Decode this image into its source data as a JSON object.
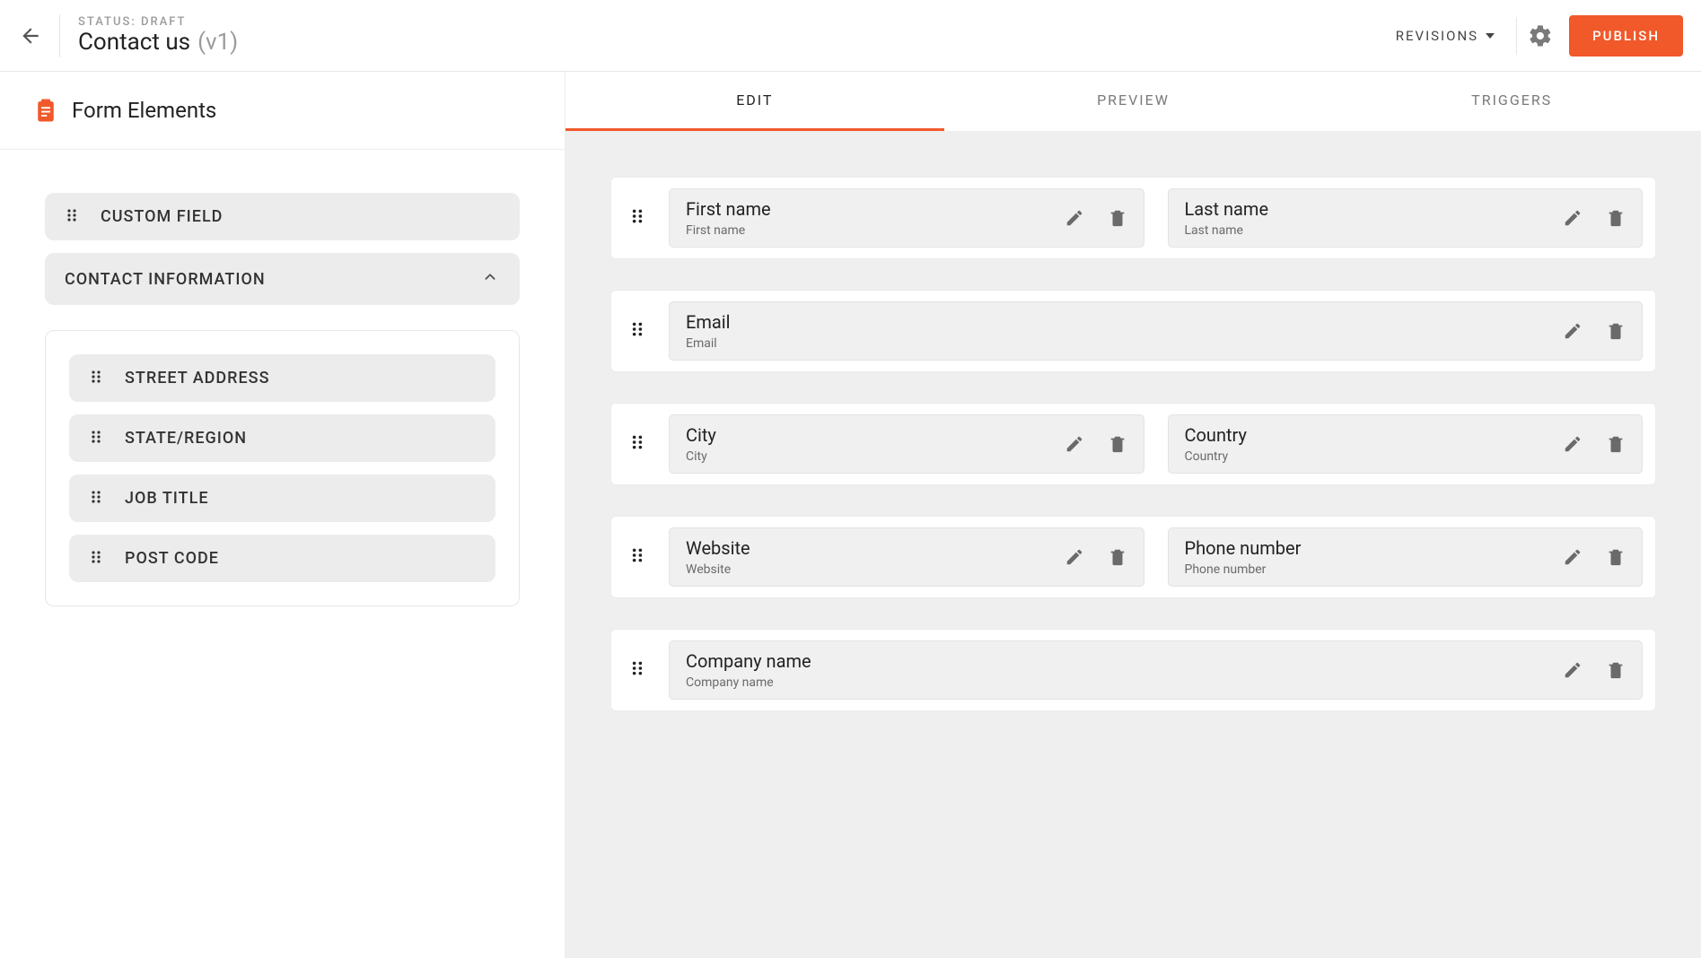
{
  "header": {
    "status_label": "STATUS: DRAFT",
    "title": "Contact us",
    "version": "(v1)",
    "revisions_label": "REVISIONS",
    "publish_label": "PUBLISH"
  },
  "sidebar": {
    "title": "Form Elements",
    "custom_field_label": "CUSTOM FIELD",
    "section_label": "CONTACT INFORMATION",
    "items": [
      {
        "label": "STREET ADDRESS"
      },
      {
        "label": "STATE/REGION"
      },
      {
        "label": "JOB TITLE"
      },
      {
        "label": "POST CODE"
      }
    ]
  },
  "tabs": {
    "edit": "EDIT",
    "preview": "PREVIEW",
    "triggers": "TRIGGERS",
    "active": "edit"
  },
  "rows": [
    {
      "fields": [
        {
          "title": "First name",
          "sub": "First name"
        },
        {
          "title": "Last name",
          "sub": "Last name"
        }
      ]
    },
    {
      "fields": [
        {
          "title": "Email",
          "sub": "Email"
        }
      ]
    },
    {
      "fields": [
        {
          "title": "City",
          "sub": "City"
        },
        {
          "title": "Country",
          "sub": "Country"
        }
      ]
    },
    {
      "fields": [
        {
          "title": "Website",
          "sub": "Website"
        },
        {
          "title": "Phone number",
          "sub": "Phone number"
        }
      ]
    },
    {
      "fields": [
        {
          "title": "Company name",
          "sub": "Company name"
        }
      ]
    }
  ],
  "colors": {
    "accent": "#f1592a"
  }
}
